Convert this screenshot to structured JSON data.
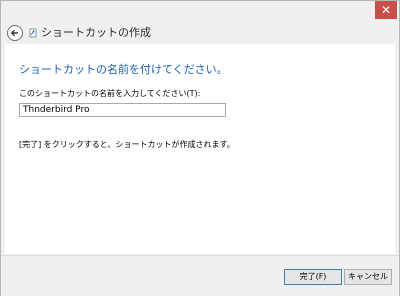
{
  "window": {
    "title": "ショートカットの作成",
    "close_glyph": "✕"
  },
  "main": {
    "heading": "ショートカットの名前を付けてください。",
    "name_label": "このショートカットの名前を入力してください(T):",
    "name_value": "Thnderbird Pro",
    "hint": "[完了] をクリックすると、ショートカットが作成されます。"
  },
  "footer": {
    "finish_label": "完了(F)",
    "cancel_label": "キャンセル"
  },
  "colors": {
    "accent": "#1d5fb1",
    "close": "#c7504a"
  }
}
